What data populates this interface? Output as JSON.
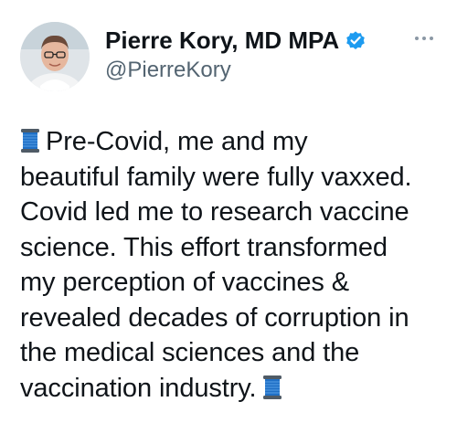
{
  "tweet": {
    "author": {
      "display_name": "Pierre Kory, MD MPA",
      "handle": "@PierreKory",
      "verified": true,
      "avatar_icon": "person-avatar"
    },
    "more_icon": "ellipsis-icon",
    "text_lines": [
      "Pre-Covid, me and my",
      "beautiful family were fully vaxxed.",
      "Covid led me to research vaccine",
      "science. This effort transformed",
      "my perception of vaccines &",
      "revealed decades of corruption in",
      "the medical sciences and the",
      "vaccination industry."
    ],
    "emoji": "thread-spool-emoji",
    "colors": {
      "text": "#0f1419",
      "secondary": "#536471",
      "verified": "#1d9bf0"
    }
  }
}
